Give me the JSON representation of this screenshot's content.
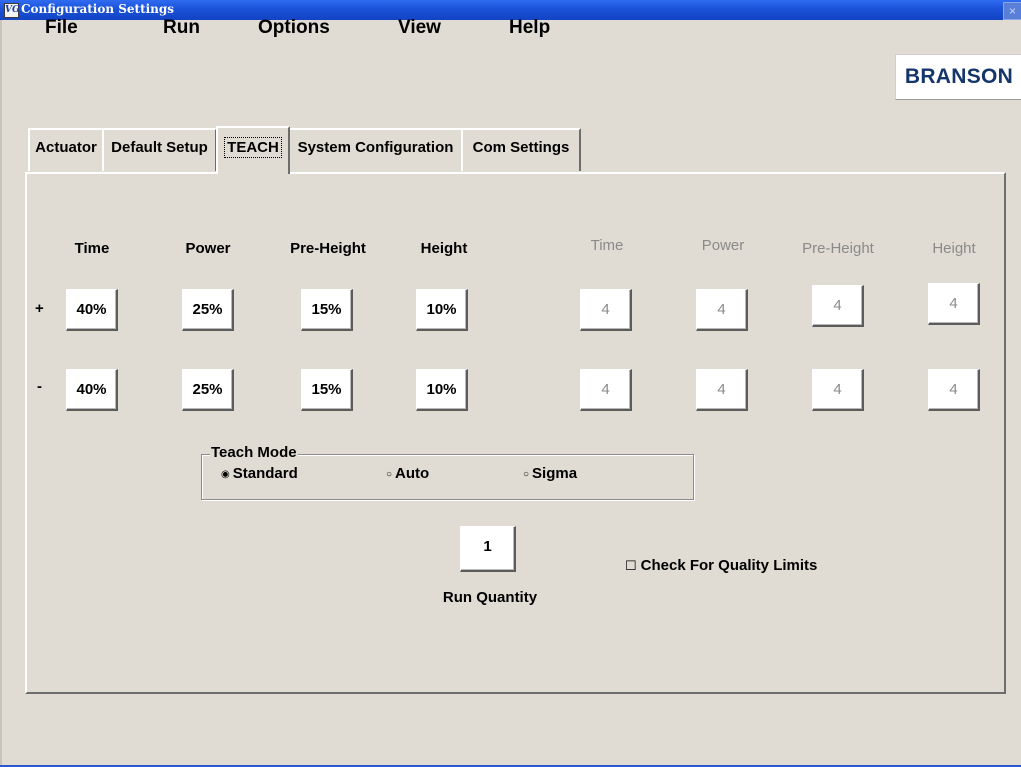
{
  "window": {
    "app_icon": "VG",
    "title": "Configuration Settings",
    "close_glyph": "×"
  },
  "menu": [
    "File",
    "Run",
    "Options",
    "View",
    "Help"
  ],
  "logo": "BRANSON",
  "tabs": [
    "Actuator",
    "Default Setup",
    "TEACH",
    "System Configuration",
    "Com Settings"
  ],
  "active_tab": "TEACH",
  "teach": {
    "headers_left": [
      "Time",
      "Power",
      "Pre-Height",
      "Height"
    ],
    "headers_right": [
      "Time",
      "Power",
      "Pre-Height",
      "Height"
    ],
    "plus_sign": "+",
    "minus_sign": "-",
    "plus_values": [
      "40%",
      "25%",
      "15%",
      "10%"
    ],
    "minus_values": [
      "40%",
      "25%",
      "15%",
      "10%"
    ],
    "plus_counts": [
      "4",
      "4",
      "4",
      "4"
    ],
    "minus_counts": [
      "4",
      "4",
      "4",
      "4"
    ],
    "mode_group": {
      "label": "Teach Mode",
      "options": [
        "Standard",
        "Auto",
        "Sigma"
      ],
      "selected": "Standard",
      "selected_glyph": "◉",
      "unselected_glyph": "○"
    },
    "run_quantity_value": "1",
    "run_quantity_label": "Run Quantity",
    "quality_limits_label": "Check For Quality Limits",
    "quality_limits_checked": false,
    "checkbox_glyph": "☐"
  }
}
